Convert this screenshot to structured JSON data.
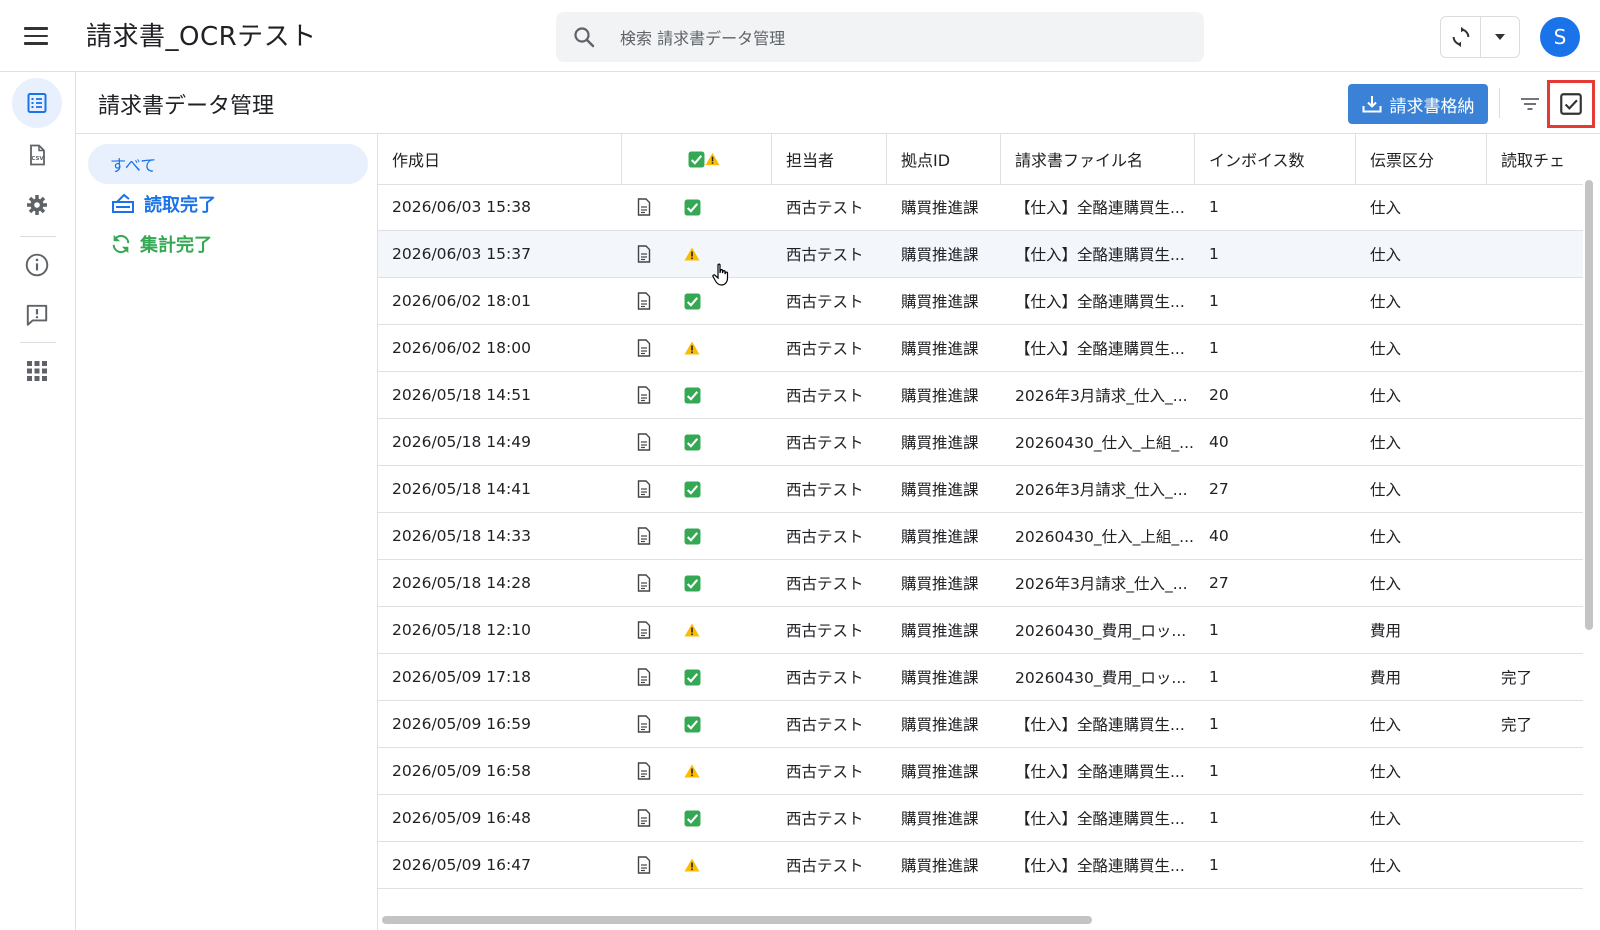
{
  "app": {
    "title": "請求書_OCRテスト",
    "avatar_letter": "S"
  },
  "search": {
    "placeholder": "検索 請求書データ管理"
  },
  "header": {
    "page_title": "請求書データ管理",
    "store_button": "請求書格納"
  },
  "filters": {
    "all": "すべて",
    "read_done": "読取完了",
    "aggregate_done": "集計完了"
  },
  "colors": {
    "accent": "#1a73e8",
    "button_blue": "#3b82d6",
    "success_green": "#34a853",
    "warning_yellow": "#fbbc04",
    "highlight_red": "#e53935"
  },
  "table": {
    "columns": [
      "作成日",
      "",
      "",
      "担当者",
      "拠点ID",
      "請求書ファイル名",
      "インボイス数",
      "伝票区分",
      "読取チェ"
    ],
    "rows": [
      {
        "date": "2026/06/03 15:38",
        "status": "ok",
        "person": "西古テスト",
        "base": "購買推進課",
        "file": "【仕入】全酪連購買生...",
        "count": "1",
        "type": "仕入",
        "read": ""
      },
      {
        "date": "2026/06/03 15:37",
        "status": "warn",
        "person": "西古テスト",
        "base": "購買推進課",
        "file": "【仕入】全酪連購買生...",
        "count": "1",
        "type": "仕入",
        "read": ""
      },
      {
        "date": "2026/06/02 18:01",
        "status": "ok",
        "person": "西古テスト",
        "base": "購買推進課",
        "file": "【仕入】全酪連購買生...",
        "count": "1",
        "type": "仕入",
        "read": ""
      },
      {
        "date": "2026/06/02 18:00",
        "status": "warn",
        "person": "西古テスト",
        "base": "購買推進課",
        "file": "【仕入】全酪連購買生...",
        "count": "1",
        "type": "仕入",
        "read": ""
      },
      {
        "date": "2026/05/18 14:51",
        "status": "ok",
        "person": "西古テスト",
        "base": "購買推進課",
        "file": "2026年3月請求_仕入_...",
        "count": "20",
        "type": "仕入",
        "read": ""
      },
      {
        "date": "2026/05/18 14:49",
        "status": "ok",
        "person": "西古テスト",
        "base": "購買推進課",
        "file": "20260430_仕入_上組_...",
        "count": "40",
        "type": "仕入",
        "read": ""
      },
      {
        "date": "2026/05/18 14:41",
        "status": "ok",
        "person": "西古テスト",
        "base": "購買推進課",
        "file": "2026年3月請求_仕入_...",
        "count": "27",
        "type": "仕入",
        "read": ""
      },
      {
        "date": "2026/05/18 14:33",
        "status": "ok",
        "person": "西古テスト",
        "base": "購買推進課",
        "file": "20260430_仕入_上組_...",
        "count": "40",
        "type": "仕入",
        "read": ""
      },
      {
        "date": "2026/05/18 14:28",
        "status": "ok",
        "person": "西古テスト",
        "base": "購買推進課",
        "file": "2026年3月請求_仕入_...",
        "count": "27",
        "type": "仕入",
        "read": ""
      },
      {
        "date": "2026/05/18 12:10",
        "status": "warn",
        "person": "西古テスト",
        "base": "購買推進課",
        "file": "20260430_費用_ロッ...",
        "count": "1",
        "type": "費用",
        "read": ""
      },
      {
        "date": "2026/05/09 17:18",
        "status": "ok",
        "person": "西古テスト",
        "base": "購買推進課",
        "file": "20260430_費用_ロッ...",
        "count": "1",
        "type": "費用",
        "read": "完了"
      },
      {
        "date": "2026/05/09 16:59",
        "status": "ok",
        "person": "西古テスト",
        "base": "購買推進課",
        "file": "【仕入】全酪連購買生...",
        "count": "1",
        "type": "仕入",
        "read": "完了"
      },
      {
        "date": "2026/05/09 16:58",
        "status": "warn",
        "person": "西古テスト",
        "base": "購買推進課",
        "file": "【仕入】全酪連購買生...",
        "count": "1",
        "type": "仕入",
        "read": ""
      },
      {
        "date": "2026/05/09 16:48",
        "status": "ok",
        "person": "西古テスト",
        "base": "購買推進課",
        "file": "【仕入】全酪連購買生...",
        "count": "1",
        "type": "仕入",
        "read": ""
      },
      {
        "date": "2026/05/09 16:47",
        "status": "warn",
        "person": "西古テスト",
        "base": "購買推進課",
        "file": "【仕入】全酪連購買生...",
        "count": "1",
        "type": "仕入",
        "read": ""
      }
    ]
  }
}
